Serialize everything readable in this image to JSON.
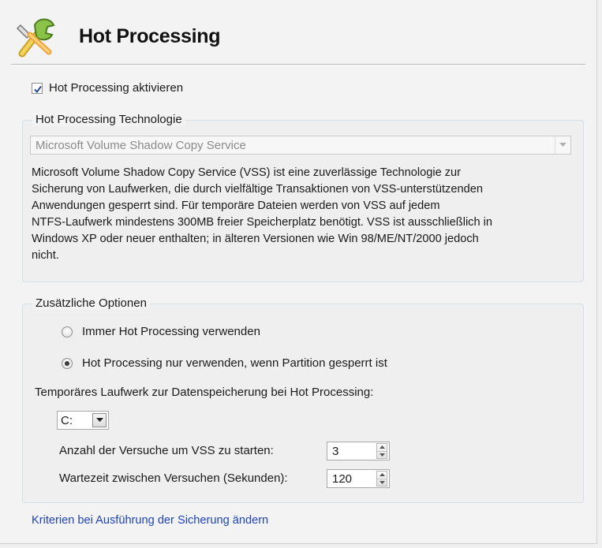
{
  "header": {
    "title": "Hot Processing",
    "icon": "wrench-tools-icon"
  },
  "enable": {
    "label": "Hot Processing aktivieren",
    "checked": true
  },
  "technology": {
    "group_title": "Hot Processing Technologie",
    "selected": "Microsoft Volume Shadow Copy Service",
    "description": [
      "Microsoft Volume Shadow Copy Service (VSS) ist eine zuverlässige Technologie zur",
      "Sicherung von Laufwerken, die durch vielfältige Transaktionen von VSS-unterstützenden",
      "Anwendungen gesperrt sind. Für temporäre Dateien werden von VSS auf jedem",
      "NTFS-Laufwerk mindestens 300MB freier Speicherplatz benötigt. VSS ist ausschließlich in",
      "Windows XP oder neuer enthalten; in älteren Versionen wie Win 98/ME/NT/2000 jedoch",
      "nicht."
    ]
  },
  "options": {
    "group_title": "Zusätzliche Optionen",
    "radio_always": {
      "label": "Immer Hot Processing verwenden",
      "checked": false
    },
    "radio_locked": {
      "label": "Hot Processing nur verwenden, wenn Partition gesperrt ist",
      "checked": true
    },
    "temp_drive_label": "Temporäres Laufwerk zur Datenspeicherung bei Hot Processing:",
    "temp_drive_value": "C:",
    "attempts_label": "Anzahl der Versuche um VSS zu starten:",
    "attempts_value": "3",
    "wait_label": "Wartezeit zwischen Versuchen (Sekunden):",
    "wait_value": "120"
  },
  "link": {
    "label": "Kriterien bei Ausführung der Sicherung ändern",
    "color": "#1f44b8"
  }
}
